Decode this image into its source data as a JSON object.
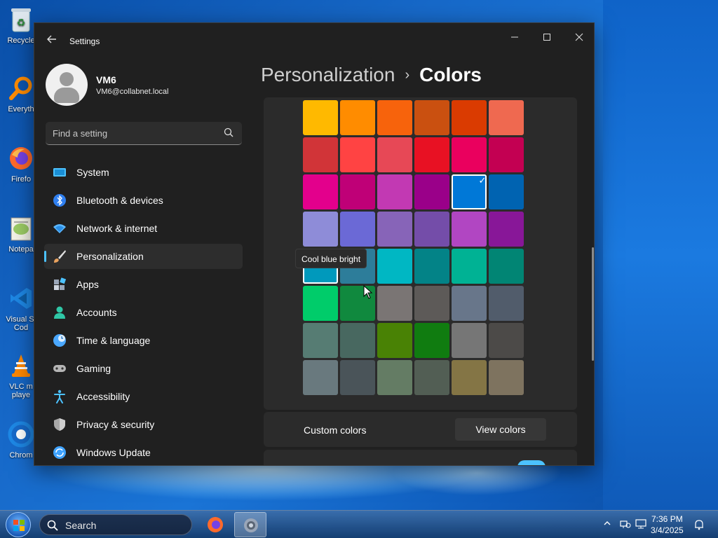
{
  "desktop": {
    "icons": [
      {
        "label": "Recycle",
        "color": "#ffffff"
      },
      {
        "label": "Everyth",
        "color": "#ff8c00"
      },
      {
        "label": "Firefo",
        "color": "#ff6a2b"
      },
      {
        "label": "Notepa",
        "color": "#b3d97a"
      },
      {
        "label": "Visual St",
        "label2": "Cod",
        "color": "#1e88e5"
      },
      {
        "label": "VLC m",
        "label2": "playe",
        "color": "#ff8800"
      },
      {
        "label": "Chrom",
        "color": "#1e88e5"
      }
    ]
  },
  "window": {
    "title": "Settings",
    "profile": {
      "name": "VM6",
      "email": "VM6@collabnet.local"
    },
    "search": {
      "placeholder": "Find a setting"
    },
    "nav": [
      {
        "label": "System",
        "icon": "monitor-icon",
        "color": "#4cc2ff"
      },
      {
        "label": "Bluetooth & devices",
        "icon": "bluetooth-icon",
        "color": "#4c8dff"
      },
      {
        "label": "Network & internet",
        "icon": "wifi-icon",
        "color": "#5cb8ff"
      },
      {
        "label": "Personalization",
        "icon": "brush-icon",
        "color": "#e8a15e",
        "active": true
      },
      {
        "label": "Apps",
        "icon": "apps-icon",
        "color": "#9aa6b8"
      },
      {
        "label": "Accounts",
        "icon": "person-icon",
        "color": "#2fc7a6"
      },
      {
        "label": "Time & language",
        "icon": "globe-clock-icon",
        "color": "#4aa8ff"
      },
      {
        "label": "Gaming",
        "icon": "gamepad-icon",
        "color": "#b5b5b5"
      },
      {
        "label": "Accessibility",
        "icon": "accessibility-icon",
        "color": "#4cc2ff"
      },
      {
        "label": "Privacy & security",
        "icon": "shield-icon",
        "color": "#a8a8a8"
      },
      {
        "label": "Windows Update",
        "icon": "update-icon",
        "color": "#3fa3ff"
      }
    ],
    "breadcrumb": {
      "parent": "Personalization",
      "separator": "›",
      "current": "Colors"
    },
    "palette": {
      "selected_index": 16,
      "hovered_index": 24,
      "tooltip": "Cool blue bright",
      "colors": [
        "#ffb900",
        "#ff8c00",
        "#f7630c",
        "#ca5010",
        "#da3b01",
        "#ef6950",
        "#d13438",
        "#ff4343",
        "#e74856",
        "#e81123",
        "#ea005e",
        "#c30052",
        "#e3008c",
        "#bf0077",
        "#c239b3",
        "#9a0089",
        "#0078d7",
        "#0063b1",
        "#8e8cd8",
        "#6b69d6",
        "#8764b8",
        "#744da9",
        "#b146c2",
        "#881798",
        "#0099bc",
        "#2d7d9a",
        "#00b7c3",
        "#038387",
        "#00b294",
        "#018574",
        "#00cc6a",
        "#10893e",
        "#7a7574",
        "#5d5a58",
        "#68768a",
        "#515c6b",
        "#567c73",
        "#486860",
        "#498205",
        "#107c10",
        "#767676",
        "#4c4a48",
        "#69797e",
        "#4a5459",
        "#647c64",
        "#525e54",
        "#847545",
        "#7e735f"
      ]
    },
    "custom_colors": {
      "label": "Custom colors",
      "button": "View colors"
    }
  },
  "taskbar": {
    "search_label": "Search",
    "time": "7:36 PM",
    "date": "3/4/2025"
  }
}
